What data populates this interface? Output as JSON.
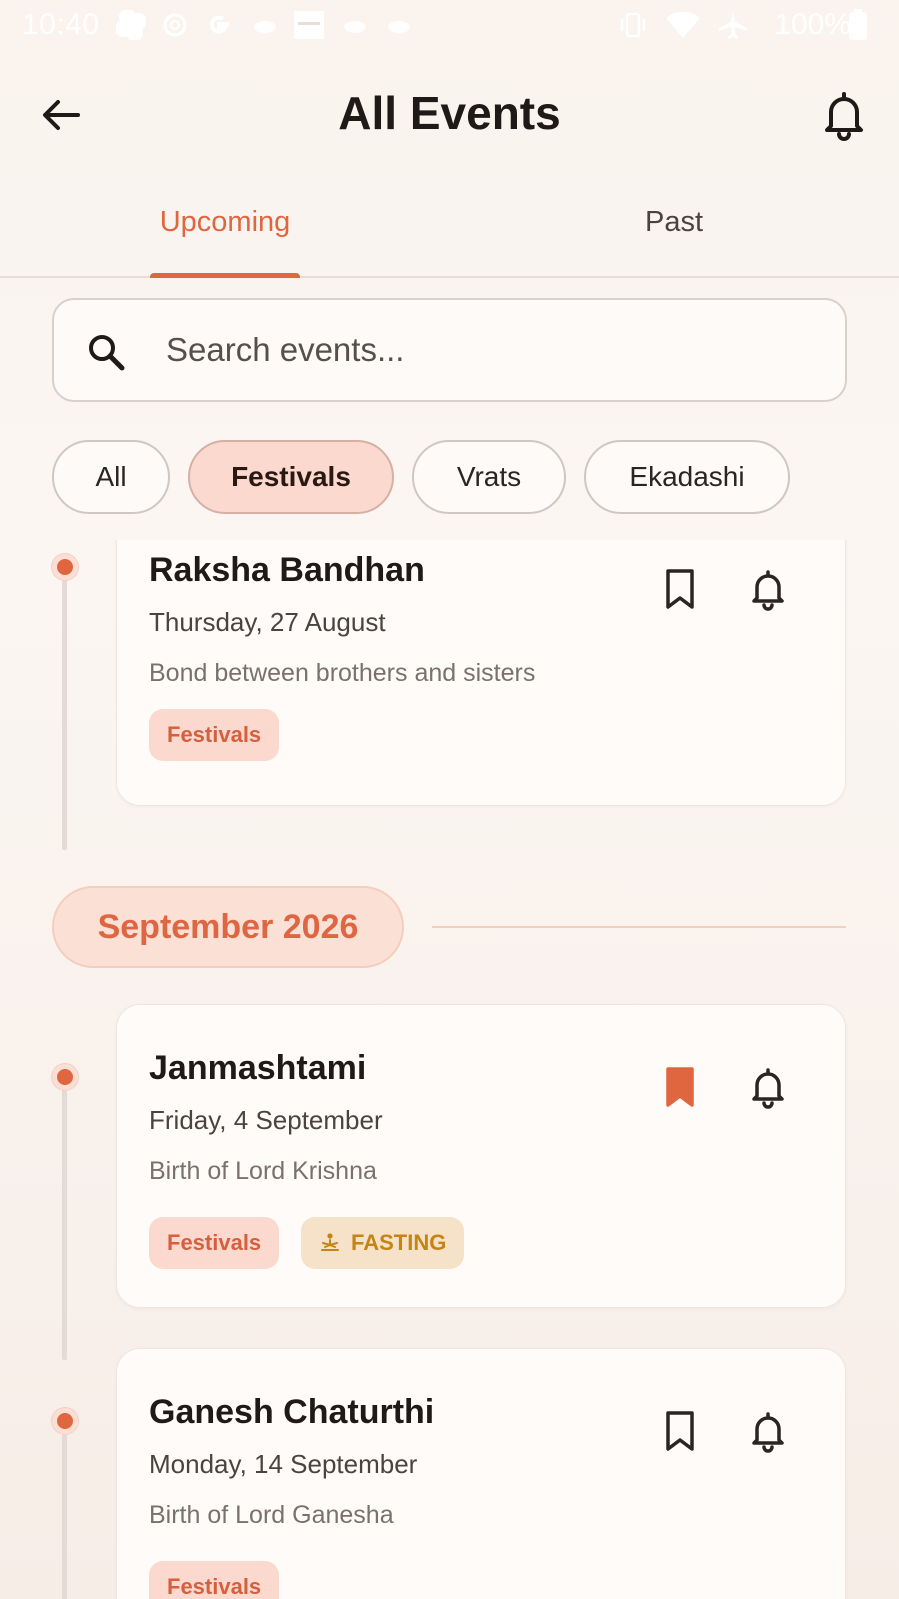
{
  "status_bar": {
    "time": "10:40",
    "battery": "100%",
    "icons": [
      "pinwheel-icon",
      "openai-icon",
      "google-icon",
      "cloud-icon",
      "news-icon",
      "cloud-icon",
      "cloud-icon",
      "vibrate-icon",
      "wifi-icon",
      "airplane-icon",
      "battery-icon"
    ]
  },
  "header": {
    "title": "All Events",
    "back_icon": "arrow-left-icon",
    "bell_icon": "bell-icon"
  },
  "tabs": [
    {
      "label": "Upcoming",
      "active": true
    },
    {
      "label": "Past",
      "active": false
    }
  ],
  "search": {
    "placeholder": "Search events...",
    "icon": "search-icon"
  },
  "filters": [
    {
      "label": "All",
      "active": false
    },
    {
      "label": "Festivals",
      "active": true
    },
    {
      "label": "Vrats",
      "active": false
    },
    {
      "label": "Ekadashi",
      "active": false
    }
  ],
  "events_before": [
    {
      "name": "Raksha Bandhan",
      "date": "Thursday, 27 August",
      "description": "Bond between brothers and sisters",
      "tags": [
        "Festivals"
      ],
      "bookmarked": false
    }
  ],
  "month_section": {
    "label": "September 2026",
    "events": [
      {
        "name": "Janmashtami",
        "date": "Friday, 4 September",
        "description": "Birth of Lord Krishna",
        "tags": [
          "Festivals"
        ],
        "fasting_label": "FASTING",
        "bookmarked": true
      },
      {
        "name": "Ganesh Chaturthi",
        "date": "Monday, 14 September",
        "description": "Birth of Lord Ganesha",
        "tags": [
          "Festivals"
        ],
        "bookmarked": false
      }
    ]
  },
  "colors": {
    "accent": "#e06640",
    "tag_bg": "#fbd9cf",
    "fasting_bg": "#f6e2c9",
    "fasting_text": "#c58414"
  }
}
